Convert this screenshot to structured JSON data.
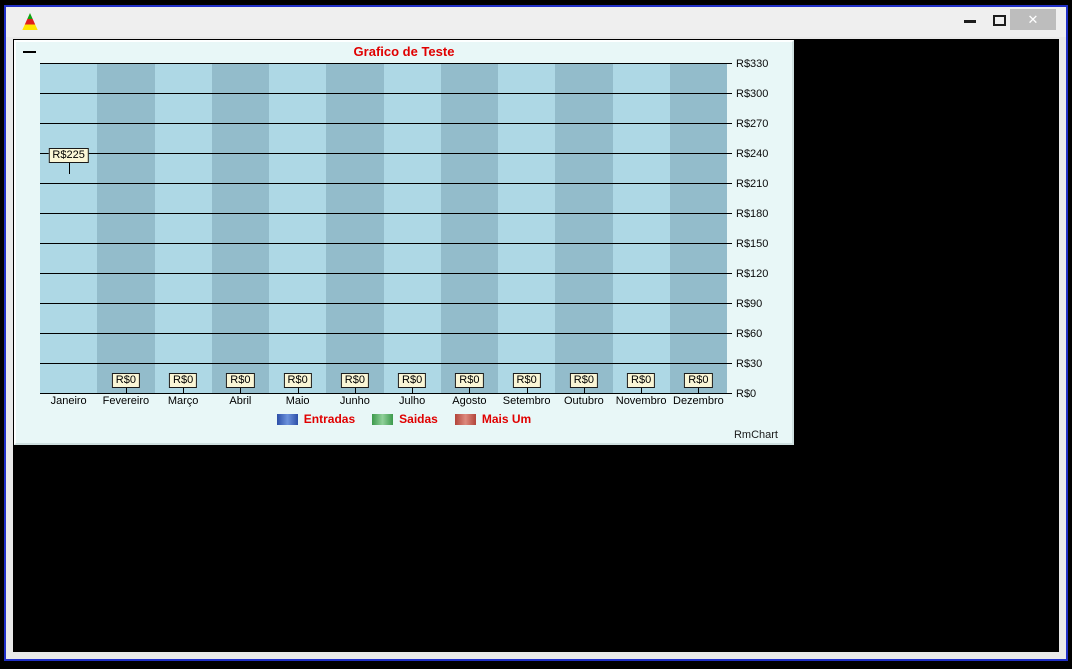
{
  "window": {
    "app_icon": "rmchart-triangle-icon",
    "controls": {
      "minimize": "minimize-glyph",
      "maximize": "maximize-glyph",
      "close_glyph": "✕"
    }
  },
  "chart": {
    "watermark": "RmChart",
    "corner_dash": "collapse-dash",
    "chart_data": {
      "type": "bar",
      "title": "Grafico de Teste",
      "title_color": "#e00000",
      "categories": [
        "Janeiro",
        "Fevereiro",
        "Março",
        "Abril",
        "Maio",
        "Junho",
        "Julho",
        "Agosto",
        "Setembro",
        "Outubro",
        "Novembro",
        "Dezembro"
      ],
      "values": [
        225,
        0,
        0,
        0,
        0,
        0,
        0,
        0,
        0,
        0,
        0,
        0
      ],
      "value_labels": [
        "R$225",
        "R$0",
        "R$0",
        "R$0",
        "R$0",
        "R$0",
        "R$0",
        "R$0",
        "R$0",
        "R$0",
        "R$0",
        "R$0"
      ],
      "y_tick_labels": [
        "R$330",
        "R$300",
        "R$270",
        "R$240",
        "R$210",
        "R$180",
        "R$150",
        "R$120",
        "R$90",
        "R$60",
        "R$30",
        "R$0"
      ],
      "y_tick_values": [
        330,
        300,
        270,
        240,
        210,
        180,
        150,
        120,
        90,
        60,
        30,
        0
      ],
      "ylim": [
        0,
        330
      ],
      "grid": true,
      "legend_position": "bottom",
      "legend": [
        {
          "label": "Entradas",
          "edge_color": "#2c4fa8",
          "center_color": "#6c92dc"
        },
        {
          "label": "Saidas",
          "edge_color": "#3c9a4c",
          "center_color": "#90d09a"
        },
        {
          "label": "Mais Um",
          "edge_color": "#b2443a",
          "center_color": "#dd8a7e"
        }
      ],
      "column_colors": {
        "light": "#aed8e5",
        "dark": "#93bccb"
      },
      "plot_background": "#e8f7f7"
    }
  }
}
